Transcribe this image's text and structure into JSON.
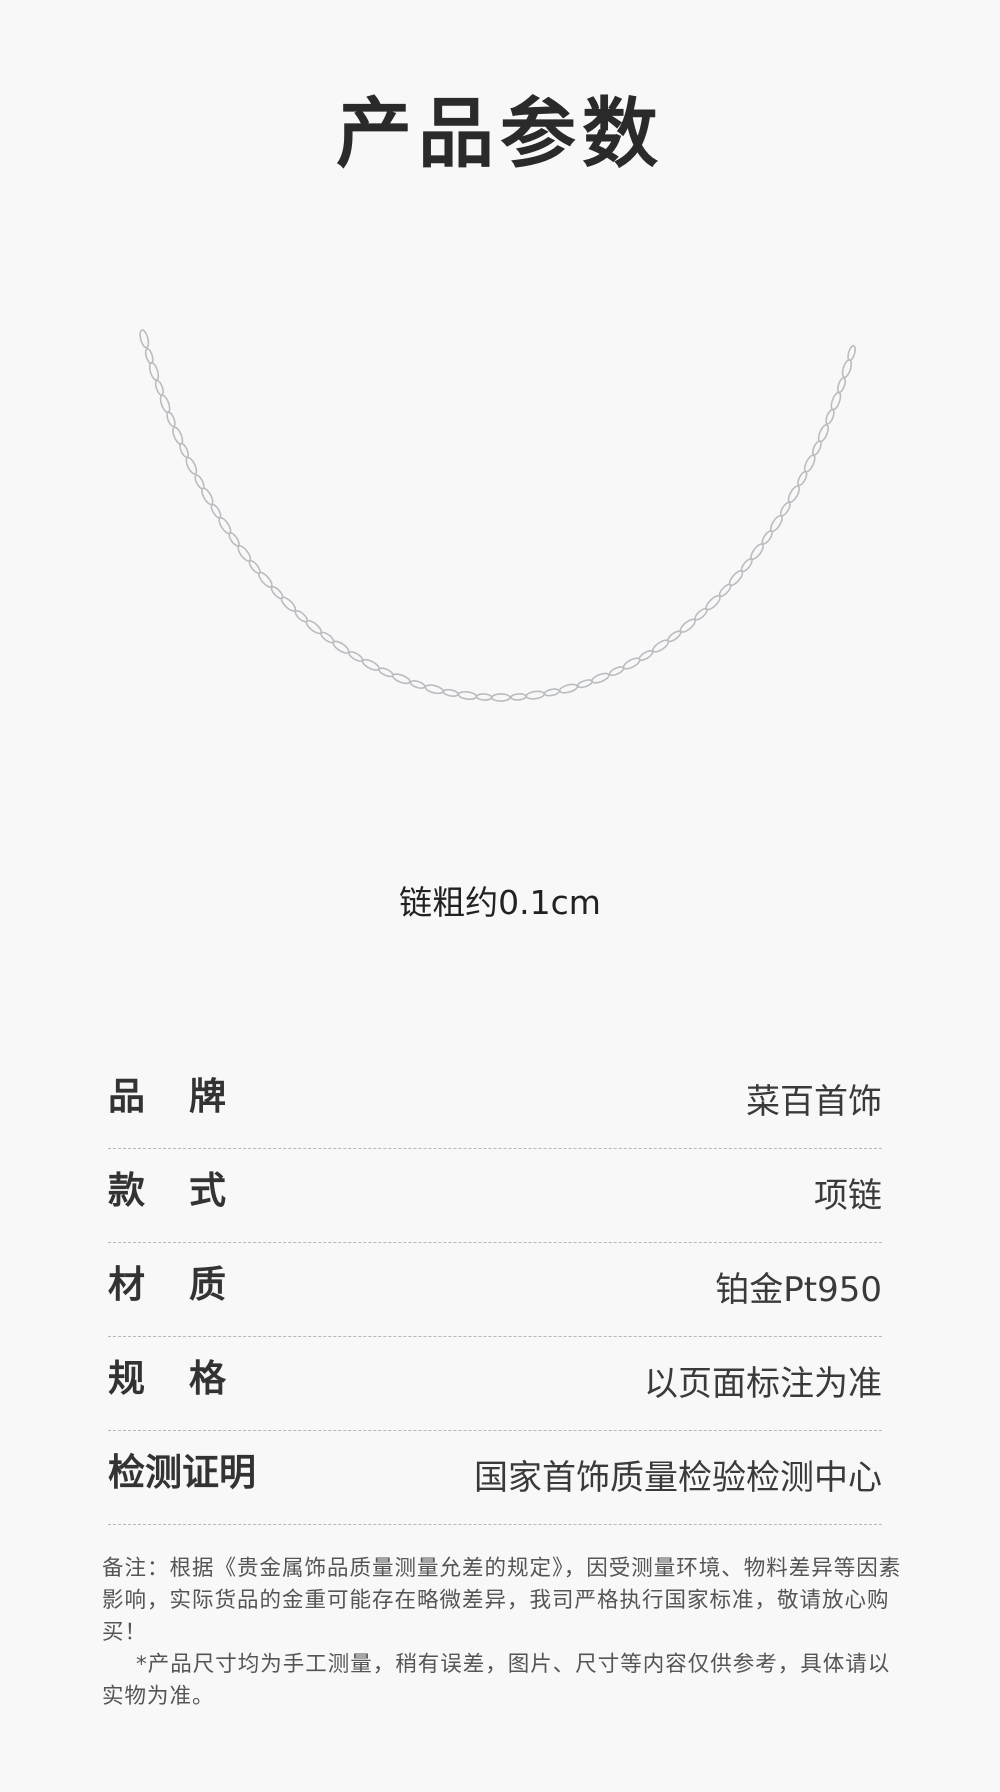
{
  "header": {
    "title": "产品参数"
  },
  "product": {
    "image_name": "platinum-necklace",
    "caption": "链粗约0.1cm"
  },
  "specs": [
    {
      "label": "品牌",
      "value": "菜百首饰",
      "spaced": true
    },
    {
      "label": "款式",
      "value": "项链",
      "spaced": true
    },
    {
      "label": "材质",
      "value": "铂金Pt950",
      "spaced": true
    },
    {
      "label": "规格",
      "value": "以页面标注为准",
      "spaced": true
    },
    {
      "label": "检测证明",
      "value": "国家首饰质量检验检测中心",
      "spaced": false
    }
  ],
  "note": {
    "paragraph1": "备注：根据《贵金属饰品质量测量允差的规定》，因受测量环境、物料差异等因素影响，实际货品的金重可能存在略微差异，我司严格执行国家标准，敬请放心购买！",
    "paragraph2": "*产品尺寸均为手工测量，稍有误差，图片、尺寸等内容仅供参考，具体请以实物为准。"
  },
  "colors": {
    "background": "#f8f8f8",
    "title": "#2a2a2a",
    "text": "#333333",
    "divider": "#b8b8b8",
    "chain": "#b9bcc0"
  }
}
